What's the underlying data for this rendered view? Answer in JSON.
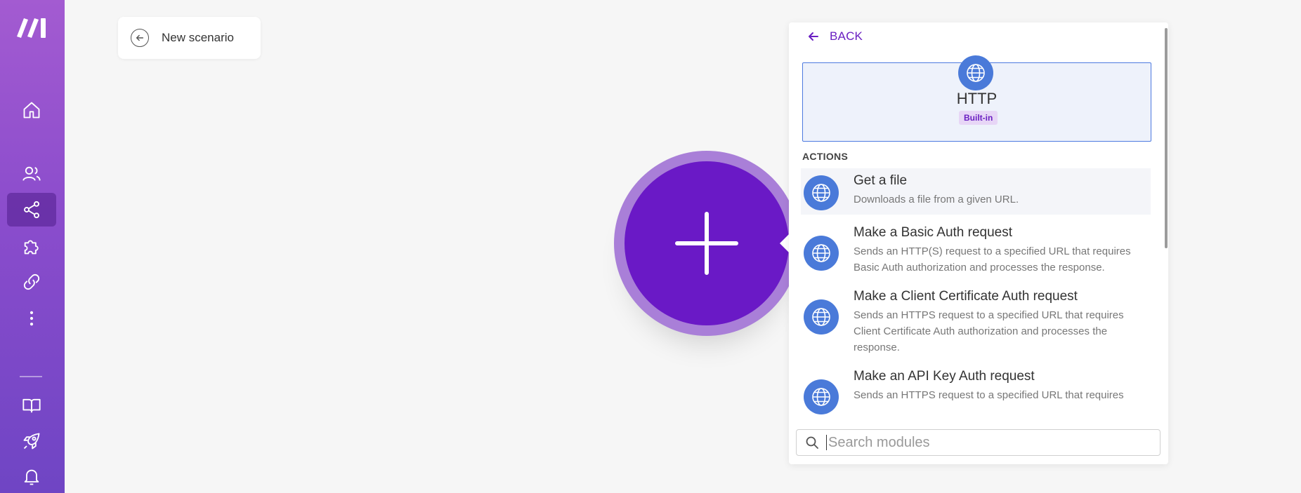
{
  "scenario": {
    "title": "New scenario"
  },
  "sidebar": {
    "items": [
      {
        "name": "home",
        "icon": "home-icon"
      },
      {
        "name": "team",
        "icon": "users-icon"
      },
      {
        "name": "scenarios",
        "icon": "share-icon",
        "active": true
      },
      {
        "name": "templates",
        "icon": "puzzle-icon"
      },
      {
        "name": "connections",
        "icon": "link-icon"
      },
      {
        "name": "more",
        "icon": "more-vertical-icon"
      },
      {
        "name": "docs",
        "icon": "book-icon"
      },
      {
        "name": "launch",
        "icon": "rocket-icon"
      },
      {
        "name": "notifications",
        "icon": "bell-icon"
      }
    ]
  },
  "panel": {
    "back_label": "BACK",
    "app": {
      "name": "HTTP",
      "badge": "Built-in",
      "icon": "globe-icon"
    },
    "section_label": "ACTIONS",
    "actions": [
      {
        "title": "Get a file",
        "desc": "Downloads a file from a given URL."
      },
      {
        "title": "Make a Basic Auth request",
        "desc": "Sends an HTTP(S) request to a specified URL that requires Basic Auth authorization and processes the response."
      },
      {
        "title": "Make a Client Certificate Auth request",
        "desc": "Sends an HTTPS request to a specified URL that requires Client Certificate Auth authorization and processes the response."
      },
      {
        "title": "Make an API Key Auth request",
        "desc": "Sends an HTTPS request to a specified URL that requires"
      }
    ],
    "search": {
      "placeholder": "Search modules",
      "value": ""
    }
  },
  "colors": {
    "accent": "#6a19c6",
    "app_icon": "#4a7ad9",
    "sidebar_top": "#a35bd1",
    "sidebar_bottom": "#6f45c4"
  }
}
